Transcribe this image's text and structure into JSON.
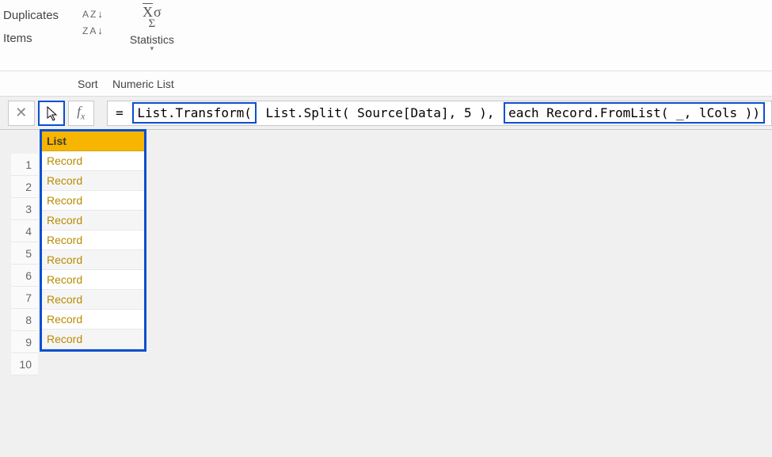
{
  "ribbon": {
    "left_label_1": "Duplicates",
    "left_label_2": "Items",
    "statistics_label": "Statistics",
    "group_sort": "Sort",
    "group_numeric": "Numeric List"
  },
  "formula": {
    "prefix": "= ",
    "seg_transform": "List.Transform(",
    "seg_split": " List.Split( Source[Data], 5 ), ",
    "seg_each": "each Record.FromList( _, lCols ))"
  },
  "grid": {
    "column_header": "List",
    "rows": [
      {
        "n": "1",
        "value": "Record"
      },
      {
        "n": "2",
        "value": "Record"
      },
      {
        "n": "3",
        "value": "Record"
      },
      {
        "n": "4",
        "value": "Record"
      },
      {
        "n": "5",
        "value": "Record"
      },
      {
        "n": "6",
        "value": "Record"
      },
      {
        "n": "7",
        "value": "Record"
      },
      {
        "n": "8",
        "value": "Record"
      },
      {
        "n": "9",
        "value": "Record"
      },
      {
        "n": "10",
        "value": "Record"
      }
    ]
  }
}
